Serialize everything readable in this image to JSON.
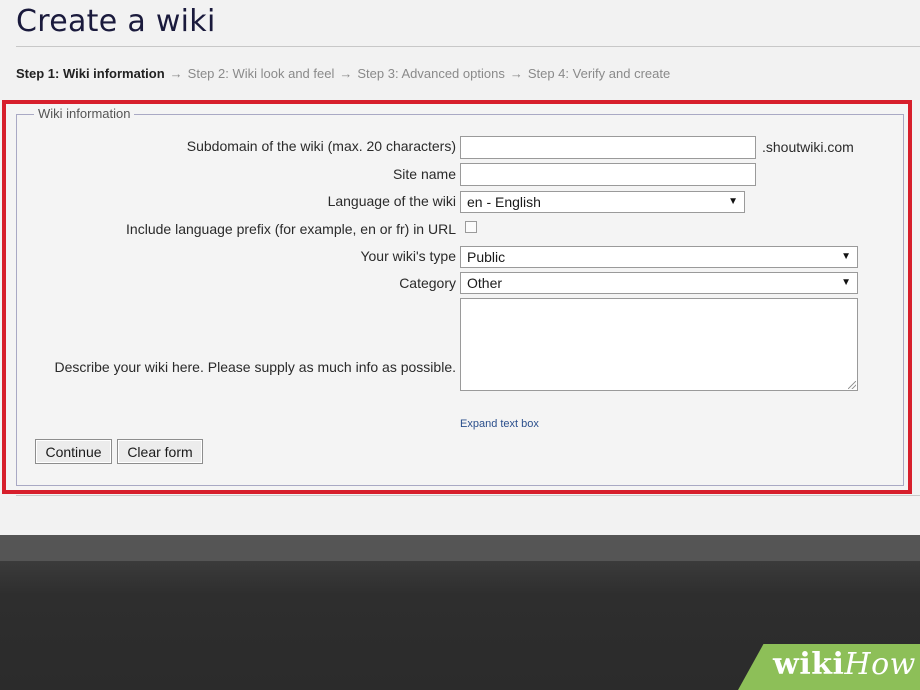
{
  "page": {
    "title": "Create a wiki"
  },
  "steps": {
    "current": "Step 1: Wiki information",
    "arrow": "→",
    "step2": "Step 2: Wiki look and feel",
    "step3": "Step 3: Advanced options",
    "step4": "Step 4: Verify and create"
  },
  "form": {
    "legend": "Wiki information",
    "subdomain": {
      "label": "Subdomain of the wiki (max. 20 characters)",
      "value": "",
      "suffix": ".shoutwiki.com"
    },
    "site_name": {
      "label": "Site name",
      "value": ""
    },
    "language": {
      "label": "Language of the wiki",
      "selected": "en - English"
    },
    "prefix": {
      "label": "Include language prefix (for example, en or fr) in URL",
      "checked": false
    },
    "wiki_type": {
      "label": "Your wiki's type",
      "selected": "Public"
    },
    "category": {
      "label": "Category",
      "selected": "Other"
    },
    "description": {
      "label": "Describe your wiki here. Please supply as much info as possible.",
      "value": ""
    },
    "expand_link": "Expand text box",
    "continue_label": "Continue",
    "clear_label": "Clear form"
  },
  "icons": {
    "dropdown_caret": "▼"
  },
  "watermark": {
    "part1": "wiki",
    "part2": "How"
  },
  "colors": {
    "highlight": "#d71f2c",
    "watermark_bg": "#8dbf58",
    "link": "#2b4f8c"
  }
}
